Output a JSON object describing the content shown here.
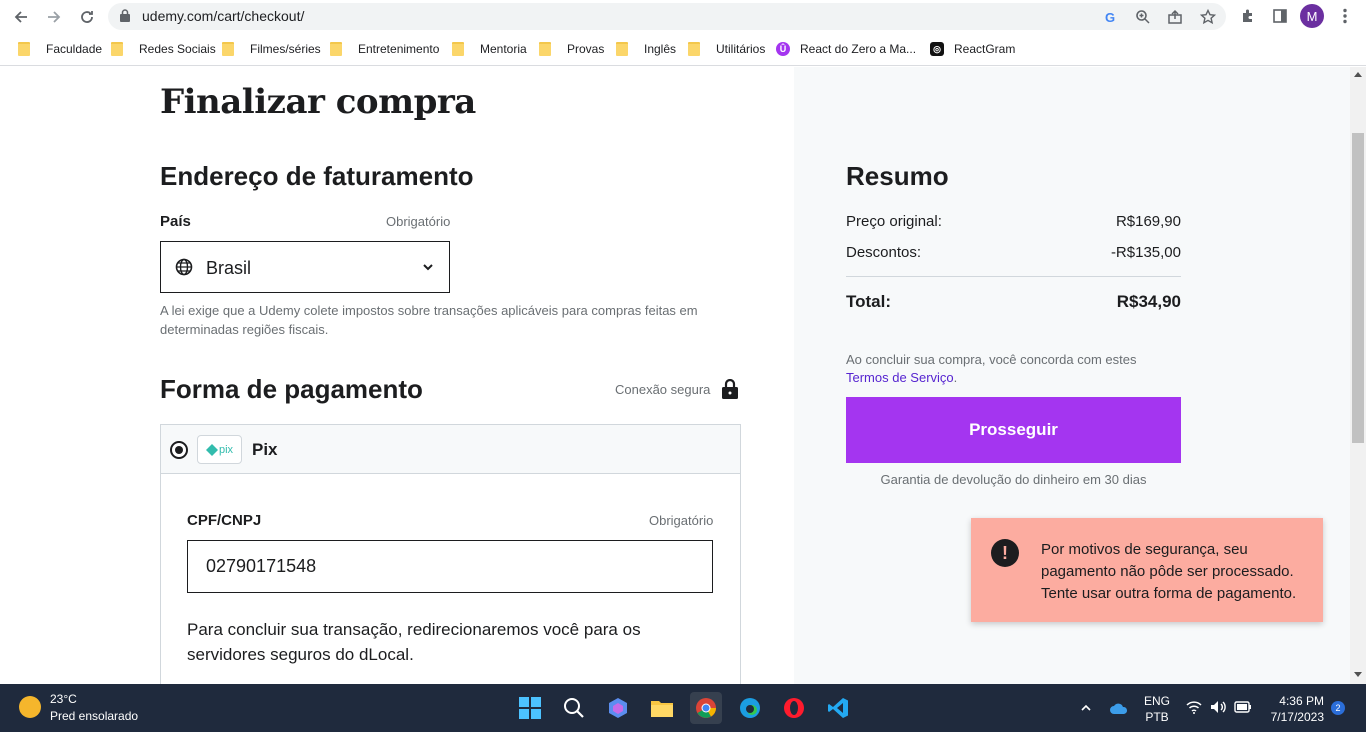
{
  "browser": {
    "url": "udemy.com/cart/checkout/",
    "avatar_letter": "M",
    "bookmarks": [
      {
        "label": "Faculdade",
        "type": "folder"
      },
      {
        "label": "Redes Sociais",
        "type": "folder"
      },
      {
        "label": "Filmes/séries",
        "type": "folder"
      },
      {
        "label": "Entretenimento",
        "type": "folder"
      },
      {
        "label": "Mentoria",
        "type": "folder"
      },
      {
        "label": "Provas",
        "type": "folder"
      },
      {
        "label": "Inglês",
        "type": "folder"
      },
      {
        "label": "Utilitários",
        "type": "folder"
      },
      {
        "label": "React do Zero a Ma...",
        "type": "site"
      },
      {
        "label": "ReactGram",
        "type": "site"
      }
    ]
  },
  "checkout": {
    "title": "Finalizar compra",
    "billing": {
      "heading": "Endereço de faturamento",
      "country_label": "País",
      "required": "Obrigatório",
      "country_value": "Brasil",
      "note": "A lei exige que a Udemy colete impostos sobre transações aplicáveis para compras feitas em determinadas regiões fiscais."
    },
    "payment": {
      "heading": "Forma de pagamento",
      "secure": "Conexão segura",
      "method": "Pix",
      "pix_logo": "pix",
      "cpf_label": "CPF/CNPJ",
      "required": "Obrigatório",
      "cpf_value": "02790171548",
      "redirect_note": "Para concluir sua transação, redirecionaremos você para os servidores seguros do dLocal."
    }
  },
  "summary": {
    "heading": "Resumo",
    "original_label": "Preço original:",
    "original_value": "R$169,90",
    "discount_label": "Descontos:",
    "discount_value": "-R$135,00",
    "total_label": "Total:",
    "total_value": "R$34,90",
    "terms_text": "Ao concluir sua compra, você concorda com estes",
    "terms_link": "Termos de Serviço",
    "button": "Prosseguir",
    "guarantee": "Garantia de devolução do dinheiro em 30 dias"
  },
  "toast": {
    "icon": "!",
    "message": "Por motivos de segurança, seu pagamento não pôde ser processado. Tente usar outra forma de pagamento."
  },
  "taskbar": {
    "temperature": "23°C",
    "weather": "Pred ensolarado",
    "lang": "ENG",
    "layout": "PTB",
    "time": "4:36 PM",
    "date": "7/17/2023",
    "notifications": "2"
  },
  "colors": {
    "accent": "#a435f0",
    "link": "#5624d0",
    "toast_bg": "#fcaca0",
    "taskbar": "#1f2a3d"
  }
}
